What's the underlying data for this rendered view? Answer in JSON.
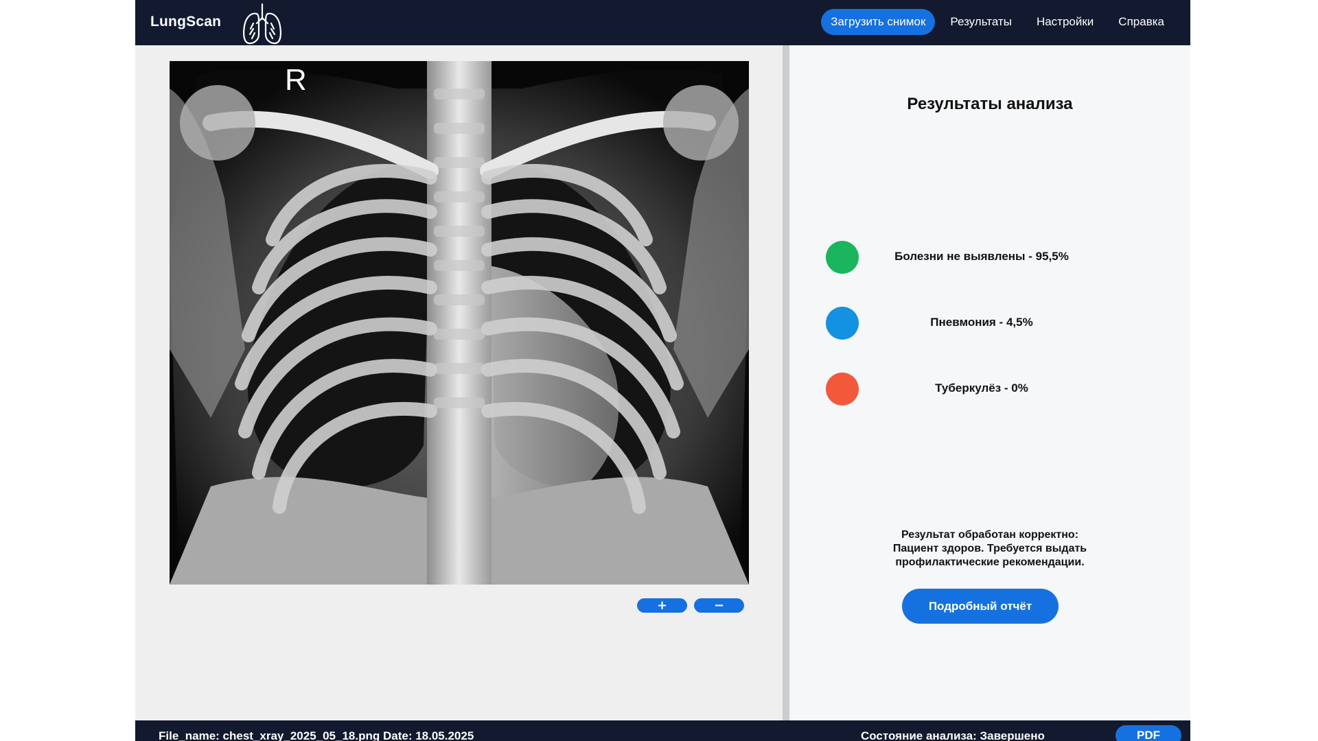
{
  "app": {
    "brand": "LungScan",
    "logo_icon": "lungs-icon"
  },
  "nav": {
    "upload": "Загрузить снимок",
    "results": "Результаты",
    "settings": "Настройки",
    "help": "Справка"
  },
  "viewer": {
    "marker": "R",
    "zoom_in": "+",
    "zoom_out": "−"
  },
  "results": {
    "title": "Результаты анализа",
    "items": [
      {
        "label": "Болезни не выявлены - 95,5%",
        "color": "#1ab55c"
      },
      {
        "label": "Пневмония - 4,5%",
        "color": "#1392e2"
      },
      {
        "label": "Туберкулёз - 0%",
        "color": "#f2583a"
      }
    ],
    "summary_lines": [
      "Результат обработан корректно:",
      "Пациент здоров. Требуется выдать",
      "профилактические рекомендации."
    ],
    "report_button": "Подробный отчёт"
  },
  "footer": {
    "file_info": "File_name: chest_xray_2025_05_18.png Date: 18.05.2025",
    "status": "Состояние анализа: Завершено",
    "pdf_button": "PDF"
  },
  "colors": {
    "topbar": "#131a2f",
    "accent": "#1571e0",
    "panel_left": "#efefef",
    "panel_right": "#f6f7f9"
  }
}
